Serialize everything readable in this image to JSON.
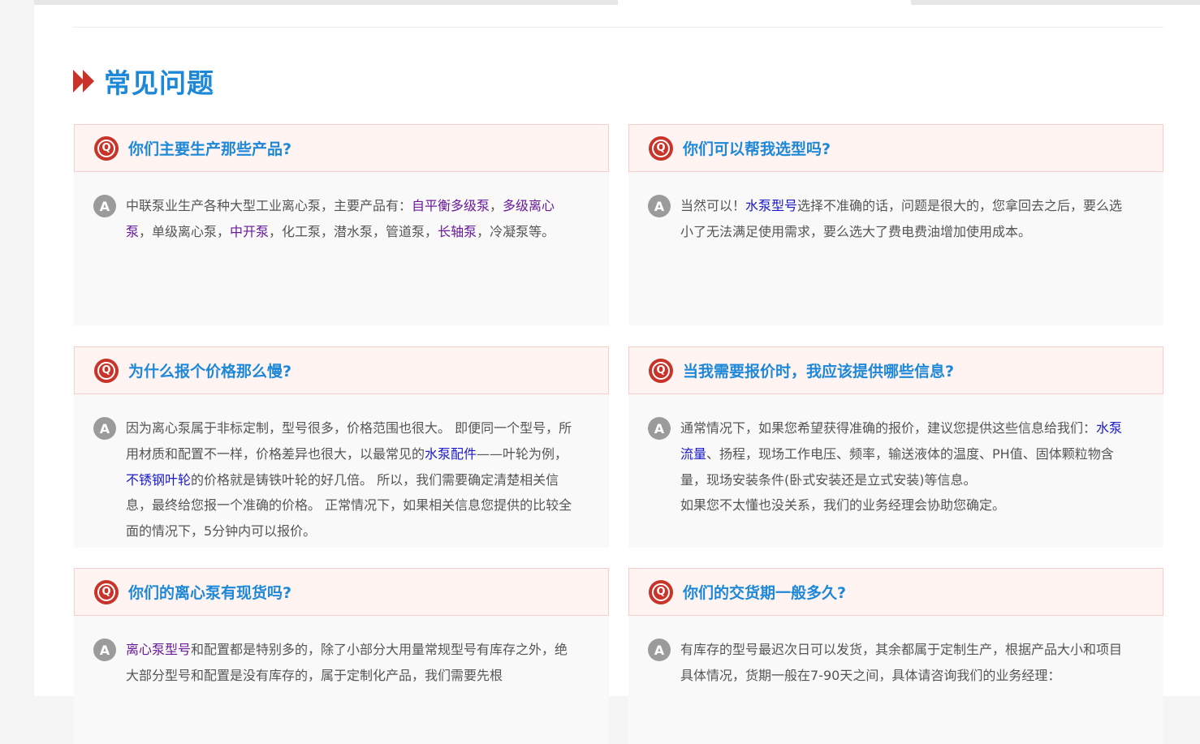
{
  "section": {
    "title": "常见问题"
  },
  "faqs": [
    {
      "question": "你们主要生产那些产品?",
      "answer_lines": [
        [
          {
            "t": "中联泵业生产各种大型工业离心泵，主要产品有："
          },
          {
            "t": "自平衡多级泵",
            "link": "purple"
          },
          {
            "t": "，"
          },
          {
            "t": "多级离心泵",
            "link": "purple"
          },
          {
            "t": "，单级离心泵，"
          },
          {
            "t": "中开泵",
            "link": "purple"
          },
          {
            "t": "，化工泵，潜水泵，管道泵，"
          },
          {
            "t": "长轴泵",
            "link": "purple"
          },
          {
            "t": "，冷凝泵等。"
          }
        ]
      ]
    },
    {
      "question": "你们可以帮我选型吗?",
      "answer_lines": [
        [
          {
            "t": "当然可以！"
          },
          {
            "t": "水泵型号",
            "link": "blue"
          },
          {
            "t": "选择不准确的话，问题是很大的，您拿回去之后，要么选小了无法满足使用需求，要么选大了费电费油增加使用成本。"
          }
        ]
      ]
    },
    {
      "question": "为什么报个价格那么慢?",
      "answer_lines": [
        [
          {
            "t": "因为离心泵属于非标定制，型号很多，价格范围也很大。 即便同一个型号，所用材质和配置不一样，价格差异也很大，以最常见的"
          },
          {
            "t": "水泵配件",
            "link": "blue"
          },
          {
            "t": "——叶轮为例，"
          },
          {
            "t": "不锈钢叶轮",
            "link": "blue"
          },
          {
            "t": "的价格就是铸铁叶轮的好几倍。 所以，我们需要确定清楚相关信息，最终给您报一个准确的价格。 正常情况下，如果相关信息您提供的比较全面的情况下，5分钟内可以报价。"
          }
        ]
      ]
    },
    {
      "question": "当我需要报价时，我应该提供哪些信息?",
      "answer_lines": [
        [
          {
            "t": "通常情况下，如果您希望获得准确的报价，建议您提供这些信息给我们："
          },
          {
            "t": "水泵流量",
            "link": "blue"
          },
          {
            "t": "、扬程，现场工作电压、频率，输送液体的温度、PH值、固体颗粒物含量，现场安装条件(卧式安装还是立式安装)等信息。"
          }
        ],
        [
          {
            "t": "如果您不太懂也没关系，我们的业务经理会协助您确定。"
          }
        ]
      ]
    },
    {
      "question": "你们的离心泵有现货吗?",
      "answer_lines": [
        [
          {
            "t": "离心泵型号",
            "link": "purple"
          },
          {
            "t": "和配置都是特别多的，除了小部分大用量常规型号有库存之外，绝大部分型号和配置是没有库存的，属于定制化产品，我们需要先根"
          }
        ]
      ]
    },
    {
      "question": "你们的交货期一般多久?",
      "answer_lines": [
        [
          {
            "t": "有库存的型号最迟次日可以发货，其余都属于定制生产，根据产品大小和项目具体情况，货期一般在7-90天之间，具体请咨询我们的业务经理："
          }
        ]
      ]
    }
  ],
  "badges": {
    "q": "Q",
    "a": "A"
  },
  "colors": {
    "accent_blue": "#1e88d8",
    "badge_red": "#c8342a",
    "badge_gray": "#9b9b9b",
    "link_purple": "#6a1b9a",
    "link_blue": "#1a1ac8"
  }
}
